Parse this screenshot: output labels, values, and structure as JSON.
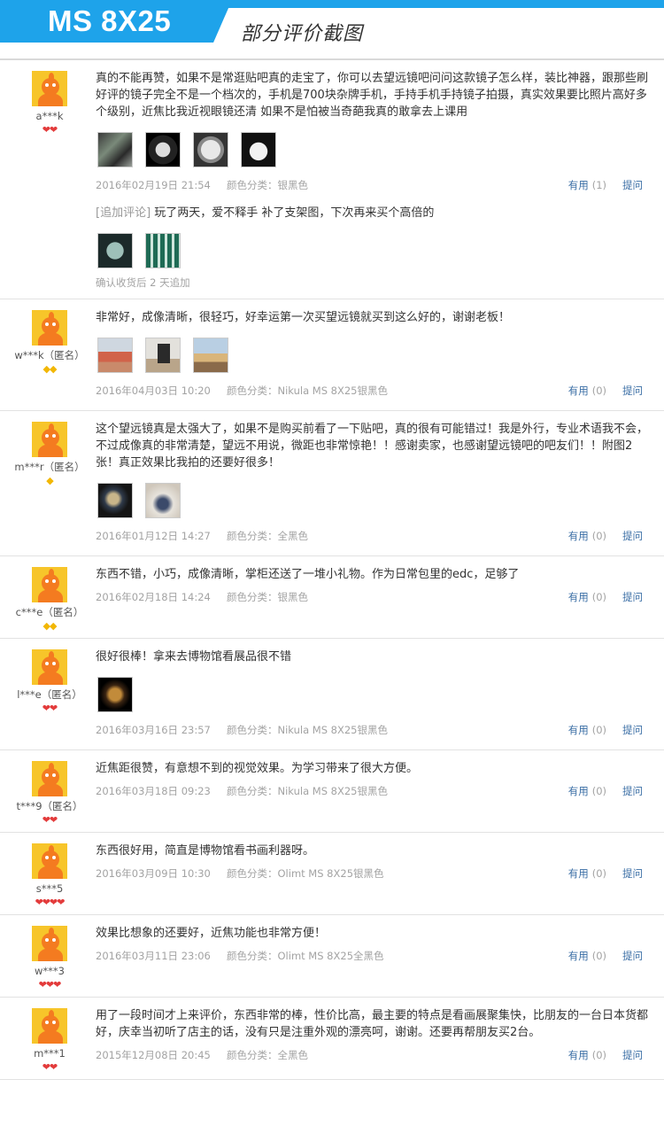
{
  "header": {
    "model": "MS 8X25",
    "subtitle": "部分评价截图"
  },
  "actions": {
    "useful_label": "有用",
    "ask_label": "提问"
  },
  "reviews": [
    {
      "user": "a***k",
      "rank": {
        "type": "heart",
        "count": 2
      },
      "text": "真的不能再赞，如果不是常逛贴吧真的走宝了，你可以去望远镜吧问问这款镜子怎么样，装比神器，跟那些刷好评的镜子完全不是一个档次的，手机是700块杂牌手机，手持手机手持镜子拍摄，真实效果要比照片高好多个级别，近焦比我近视眼镜还清 如果不是怕被当奇葩我真的敢拿去上课用",
      "photos": [
        "ph1",
        "ph2",
        "ph3",
        "ph4"
      ],
      "date": "2016年02月19日 21:54",
      "color": "颜色分类：银黑色",
      "useful_count": "(1)",
      "append": {
        "tag": "[追加评论]",
        "text": "玩了两天，爱不释手 补了支架图，下次再来买个高倍的",
        "photos": [
          "ph5",
          "ph6"
        ],
        "time": "确认收货后 2 天追加"
      }
    },
    {
      "user": "w***k（匿名）",
      "rank": {
        "type": "diamond",
        "count": 2
      },
      "text": "非常好，成像清晰，很轻巧，好幸运第一次买望远镜就买到这么好的，谢谢老板！",
      "photos": [
        "ph7",
        "ph8",
        "ph9"
      ],
      "date": "2016年04月03日 10:20",
      "color": "颜色分类：Nikula MS 8X25银黑色",
      "useful_count": "(0)"
    },
    {
      "user": "m***r（匿名）",
      "rank": {
        "type": "diamond",
        "count": 1
      },
      "text": "这个望远镜真是太强大了，如果不是购买前看了一下贴吧，真的很有可能错过！我是外行，专业术语我不会，不过成像真的非常清楚，望远不用说，微距也非常惊艳！！感谢卖家，也感谢望远镜吧的吧友们！！附图2张！真正效果比我拍的还要好很多！",
      "photos": [
        "ph10",
        "ph11"
      ],
      "date": "2016年01月12日 14:27",
      "color": "颜色分类：全黑色",
      "useful_count": "(0)"
    },
    {
      "user": "c***e（匿名）",
      "rank": {
        "type": "diamond",
        "count": 2
      },
      "text": "东西不错，小巧，成像清晰，掌柜还送了一堆小礼物。作为日常包里的edc，足够了",
      "photos": [],
      "date": "2016年02月18日 14:24",
      "color": "颜色分类：银黑色",
      "useful_count": "(0)"
    },
    {
      "user": "l***e（匿名）",
      "rank": {
        "type": "heart",
        "count": 2
      },
      "text": "很好很棒！拿来去博物馆看展品很不错",
      "photos": [
        "ph12"
      ],
      "date": "2016年03月16日 23:57",
      "color": "颜色分类：Nikula MS 8X25银黑色",
      "useful_count": "(0)"
    },
    {
      "user": "t***9（匿名）",
      "rank": {
        "type": "heart",
        "count": 2
      },
      "text": "近焦距很赞，有意想不到的视觉效果。为学习带来了很大方便。",
      "photos": [],
      "date": "2016年03月18日 09:23",
      "color": "颜色分类：Nikula MS 8X25银黑色",
      "useful_count": "(0)"
    },
    {
      "user": "s***5",
      "rank": {
        "type": "heart",
        "count": 4
      },
      "text": "东西很好用，简直是博物馆看书画利器呀。",
      "photos": [],
      "date": "2016年03月09日 10:30",
      "color": "颜色分类：Olimt MS 8X25银黑色",
      "useful_count": "(0)"
    },
    {
      "user": "w***3",
      "rank": {
        "type": "heart",
        "count": 3
      },
      "text": "效果比想象的还要好，近焦功能也非常方便！",
      "photos": [],
      "date": "2016年03月11日 23:06",
      "color": "颜色分类：Olimt MS 8X25全黑色",
      "useful_count": "(0)"
    },
    {
      "user": "m***1",
      "rank": {
        "type": "heart",
        "count": 2
      },
      "text": "用了一段时间才上来评价，东西非常的棒，性价比高，最主要的特点是看画展聚集快，比朋友的一台日本货都好，庆幸当初听了店主的话，没有只是注重外观的漂亮呵，谢谢。还要再帮朋友买2台。",
      "photos": [],
      "date": "2015年12月08日 20:45",
      "color": "颜色分类：全黑色",
      "useful_count": "(0)"
    }
  ]
}
